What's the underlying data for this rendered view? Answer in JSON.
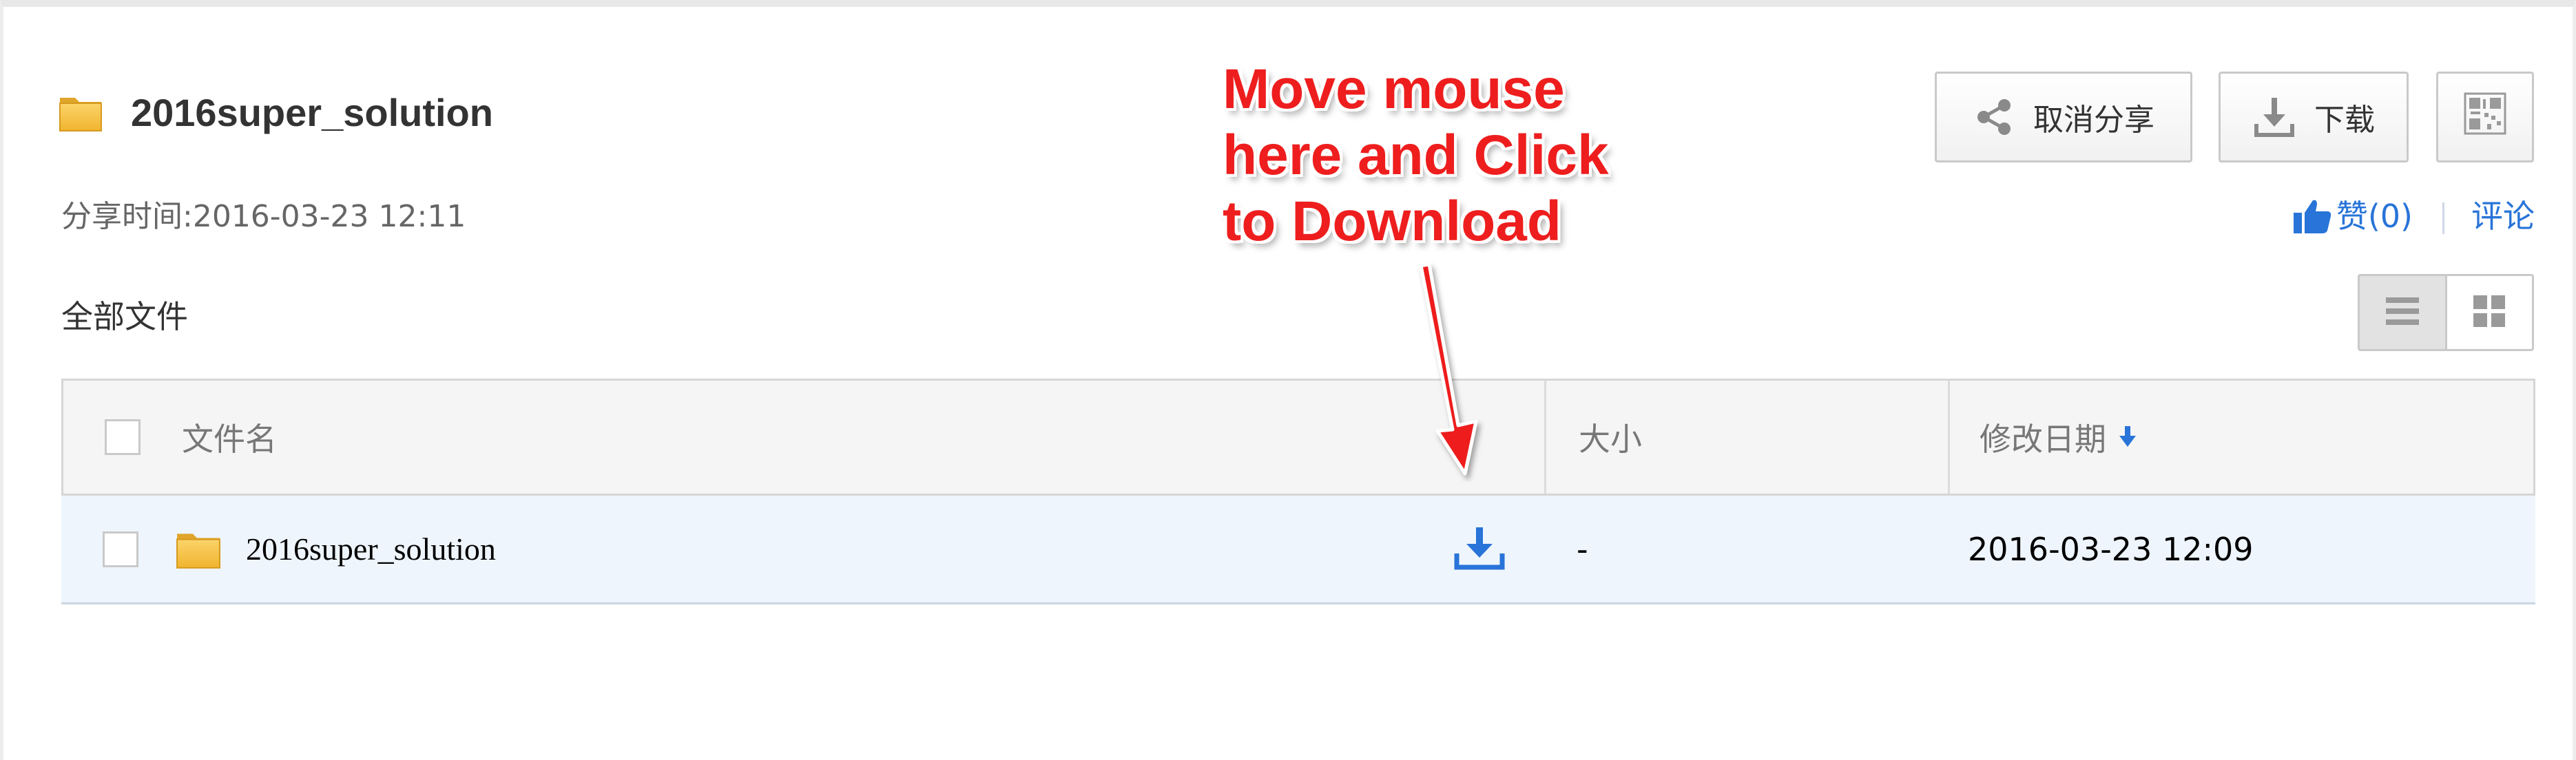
{
  "header": {
    "title": "2016super_solution",
    "share_time_label": "分享时间:",
    "share_time_value": "2016-03-23 12:11",
    "all_files_label": "全部文件",
    "folder_icon": "folder-icon"
  },
  "toolbar": {
    "cancel_share_label": "取消分享",
    "cancel_share_icon": "share-icon",
    "download_label": "下载",
    "download_icon": "download-icon",
    "qr_icon": "qr-code-icon"
  },
  "social": {
    "like_label": "赞(0)",
    "like_icon": "thumbs-up-icon",
    "separator": "|",
    "comment_label": "评论"
  },
  "view_toggle": {
    "list_icon": "list-view-icon",
    "grid_icon": "grid-view-icon",
    "active": "list"
  },
  "table": {
    "columns": {
      "name": "文件名",
      "size": "大小",
      "modified": "修改日期"
    },
    "sort_icon": "sort-down-arrow-icon",
    "rows": [
      {
        "name": "2016super_solution",
        "size": "-",
        "modified": "2016-03-23 12:09",
        "icon": "folder-icon",
        "action_icon": "download-icon"
      }
    ]
  },
  "annotation": {
    "lines": [
      "Move mouse",
      "here and Click",
      "to Download"
    ],
    "color": "#ee1e1e"
  },
  "colors": {
    "link_blue": "#2874d8",
    "row_highlight": "#eef5fd",
    "header_bg": "#f5f5f5"
  }
}
